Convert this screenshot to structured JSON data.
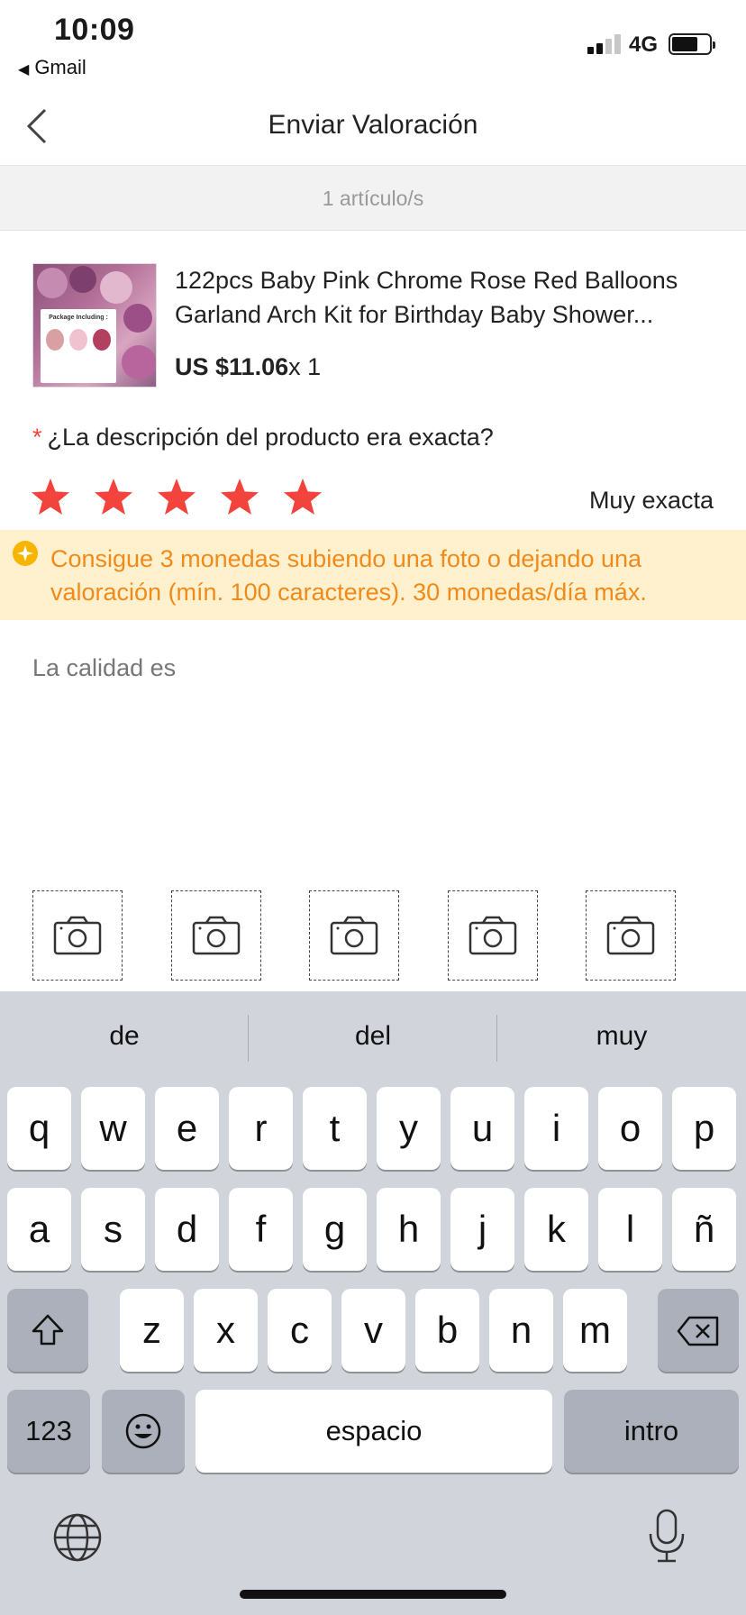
{
  "status": {
    "time": "10:09",
    "back_app": "Gmail",
    "network": "4G"
  },
  "nav": {
    "title": "Enviar Valoración"
  },
  "items_bar": {
    "text": "1 artículo/s"
  },
  "product": {
    "title": "122pcs Baby Pink Chrome Rose Red Balloons Garland Arch Kit  for Birthday  Baby Shower...",
    "price": "US $11.06",
    "quantity": "x 1",
    "thumb_label": "Package Including :"
  },
  "question": {
    "required_mark": "*",
    "text": "¿La descripción del producto era exacta?"
  },
  "rating": {
    "stars": 5,
    "max": 5,
    "label": "Muy exacta",
    "star_color": "#f2433c"
  },
  "promo": {
    "text": "Consigue 3 monedas subiendo una foto o dejando una valoración (mín. 100 caracteres). 30 monedas/día máx."
  },
  "review": {
    "value": "La calidad es"
  },
  "photos": {
    "count": 5,
    "icon": "camera-icon"
  },
  "keyboard": {
    "suggestions": [
      "de",
      "del",
      "muy"
    ],
    "row1": [
      "q",
      "w",
      "e",
      "r",
      "t",
      "y",
      "u",
      "i",
      "o",
      "p"
    ],
    "row2": [
      "a",
      "s",
      "d",
      "f",
      "g",
      "h",
      "j",
      "k",
      "l",
      "ñ"
    ],
    "row3": [
      "z",
      "x",
      "c",
      "v",
      "b",
      "n",
      "m"
    ],
    "numbers_key": "123",
    "space_key": "espacio",
    "return_key": "intro"
  }
}
